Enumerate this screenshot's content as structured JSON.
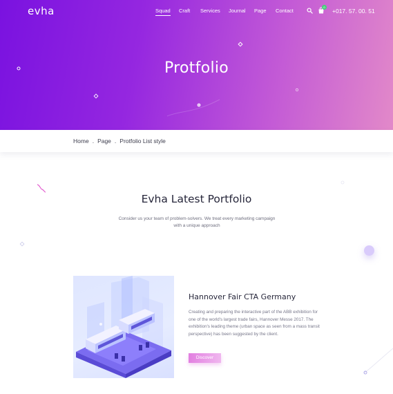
{
  "header": {
    "logo": "evha",
    "nav": [
      {
        "label": "Squad",
        "active": true
      },
      {
        "label": "Craft",
        "active": false
      },
      {
        "label": "Services",
        "active": false
      },
      {
        "label": "Journal",
        "active": false
      },
      {
        "label": "Page",
        "active": false
      },
      {
        "label": "Contact",
        "active": false
      }
    ],
    "search_icon": "search-icon",
    "cart_icon": "shopping-bag-icon",
    "cart_count": "0",
    "phone": "+017. 57. 00. 51"
  },
  "hero": {
    "title": "Protfolio",
    "gradient": [
      "#7a12e0",
      "#e289c9"
    ]
  },
  "breadcrumb": {
    "items": [
      "Home",
      "Page",
      "Protfolio List style"
    ],
    "separator": "."
  },
  "section": {
    "title": "Evha Latest Portfolio",
    "description": "Consider us your team of problem-solvers. We treat every marketing campaign with a unique approach"
  },
  "portfolio": [
    {
      "title": "Hannover Fair CTA Germany",
      "description": "Creating and preparing the interactive part of the ABB exhibition for one of the world's largest trade fairs, Hannover Messe 2017. The exhibition's leading theme (urban space as seen from a mass transit perspective) has been suggested by the client.",
      "button": "Discover"
    }
  ],
  "colors": {
    "accent": "#9527e0",
    "button": "#e27fe0",
    "badge": "#46d07a"
  }
}
